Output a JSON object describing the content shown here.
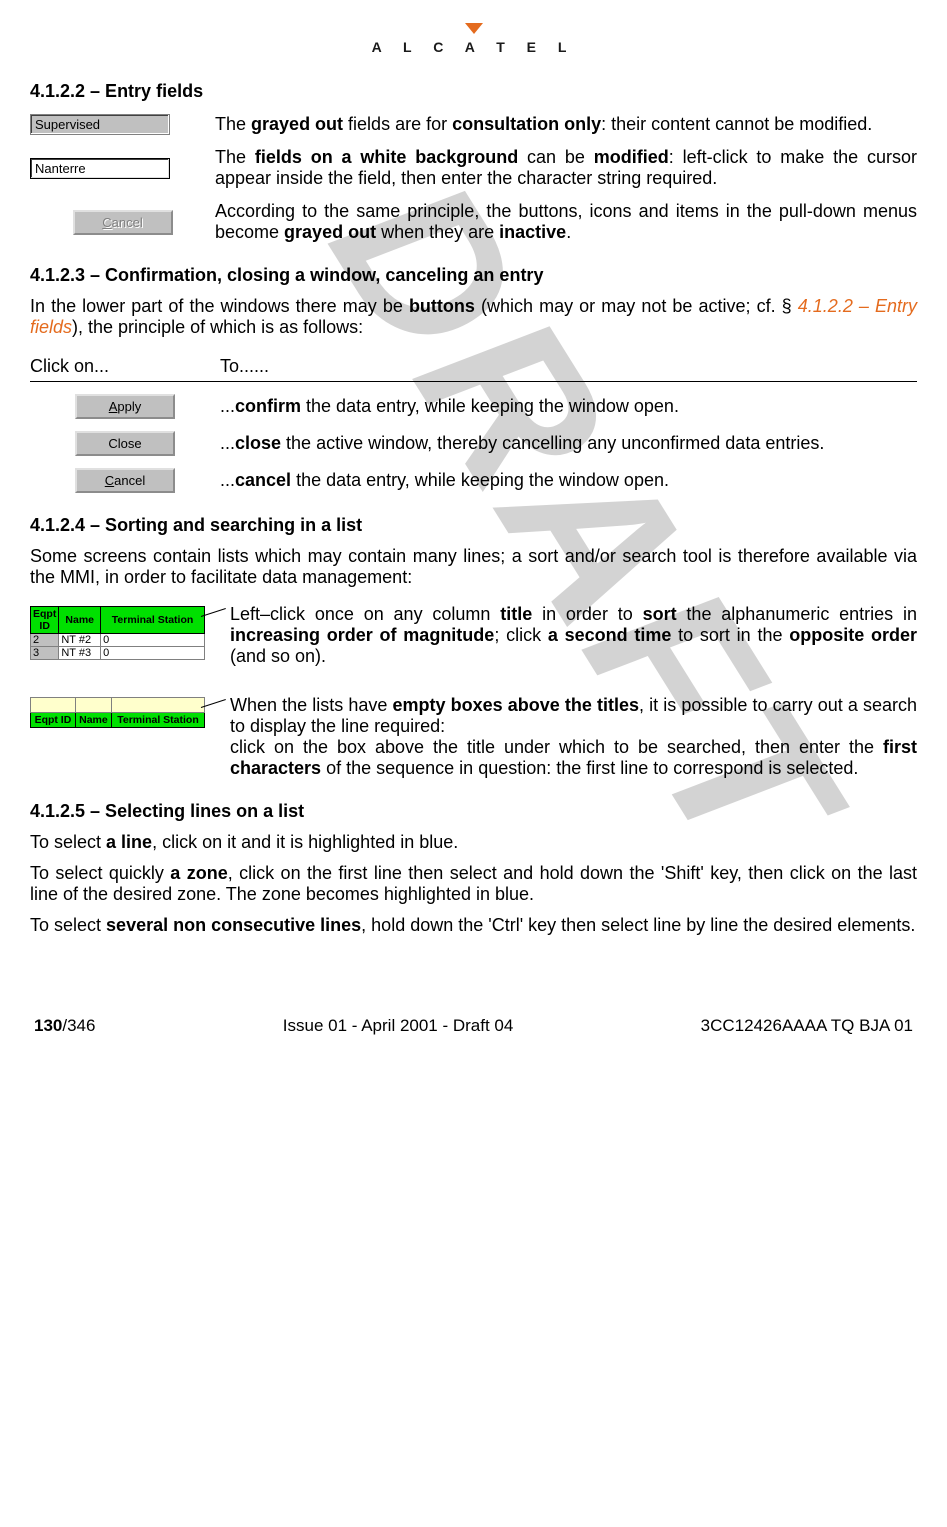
{
  "logo": {
    "brand": "A L C A T E L"
  },
  "watermark": "DRAFT",
  "s4122": {
    "heading": "4.1.2.2 –   Entry fields",
    "grey_value": "Supervised",
    "grey_text_a": "The ",
    "grey_text_b": "grayed out",
    "grey_text_c": " fields are for ",
    "grey_text_d": "consultation only",
    "grey_text_e": ": their content cannot be modified.",
    "white_value": "Nanterre",
    "white_text_a": "The ",
    "white_text_b": "fields on a white background",
    "white_text_c": " can be ",
    "white_text_d": "modified",
    "white_text_e": ": left-click to make the cursor appear inside the field, then enter the character string required.",
    "cancel_label_u": "C",
    "cancel_label_rest": "ancel",
    "cancel_text_a": "According to the same principle, the buttons, icons and items in the pull-down menus become ",
    "cancel_text_b": "grayed out",
    "cancel_text_c": " when they are ",
    "cancel_text_d": "inactive",
    "cancel_text_e": "."
  },
  "s4123": {
    "heading": "4.1.2.3 –   Confirmation, closing a window, canceling an entry",
    "intro_a": "In the lower part of the windows there may be ",
    "intro_b": "buttons",
    "intro_c": " (which may or may not be active; cf. § ",
    "intro_ref": "4.1.2.2 – Entry fields",
    "intro_d": "), the principle of which is as follows:",
    "th_click": "Click on...",
    "th_to": "To......",
    "apply_u": "A",
    "apply_rest": "pply",
    "apply_desc_a": "...",
    "apply_desc_b": "confirm",
    "apply_desc_c": " the data entry, while keeping the window open.",
    "close_label": "Close",
    "close_desc_a": "...",
    "close_desc_b": "close",
    "close_desc_c": " the active window, thereby cancelling any unconfirmed data entries.",
    "cancel_u": "C",
    "cancel_rest": "ancel",
    "cancel_desc_a": "...",
    "cancel_desc_b": "cancel",
    "cancel_desc_c": " the data entry, while keeping the window open."
  },
  "s4124": {
    "heading": "4.1.2.4 –   Sorting and searching in a list",
    "intro": "Some screens contain lists which may contain many lines; a sort and/or search tool is therefore available via the MMI, in order to facilitate data management:",
    "tbl1": {
      "h1": "Eqpt ID",
      "h2": "Name",
      "h3": "Terminal Station",
      "r1c0": "2",
      "r1c1": "NT #2",
      "r1c2": "0",
      "r2c0": "3",
      "r2c1": "NT #3",
      "r2c2": "0"
    },
    "sort_a": "Left–click once on any column ",
    "sort_b": "title",
    "sort_c": " in order to ",
    "sort_d": "sort",
    "sort_e": " the alphanumeric entries in ",
    "sort_f": "increasing order of magnitude",
    "sort_g": "; click ",
    "sort_h": "a second time",
    "sort_i": " to sort in the ",
    "sort_j": "opposite order",
    "sort_k": " (and so on).",
    "tbl2": {
      "h1": "Eqpt ID",
      "h2": "Name",
      "h3": "Terminal Station"
    },
    "search_a": "When the lists have ",
    "search_b": "empty boxes above the titles",
    "search_c": ", it is possible to carry out a search to display the line required:",
    "search_d": "click on the box above the title under which to be searched, then enter the ",
    "search_e": "first characters",
    "search_f": " of the sequence in question: the first line to correspond is selected."
  },
  "s4125": {
    "heading": "4.1.2.5 –   Selecting lines on a list",
    "p1a": "To select ",
    "p1b": "a line",
    "p1c": ", click on it and it is highlighted in blue.",
    "p2a": "To select quickly ",
    "p2b": "a zone",
    "p2c": ", click on the first line then select and hold down the 'Shift' key, then click on the last line of the desired zone. The zone becomes highlighted in blue.",
    "p3a": "To select ",
    "p3b": "several non consecutive lines",
    "p3c": ", hold down the 'Ctrl' key then select line by line the desired elements."
  },
  "footer": {
    "page_bold": "130",
    "page_total": "/346",
    "issue": "Issue 01 - April 2001 - Draft 04",
    "docref": "3CC12426AAAA TQ BJA 01"
  }
}
